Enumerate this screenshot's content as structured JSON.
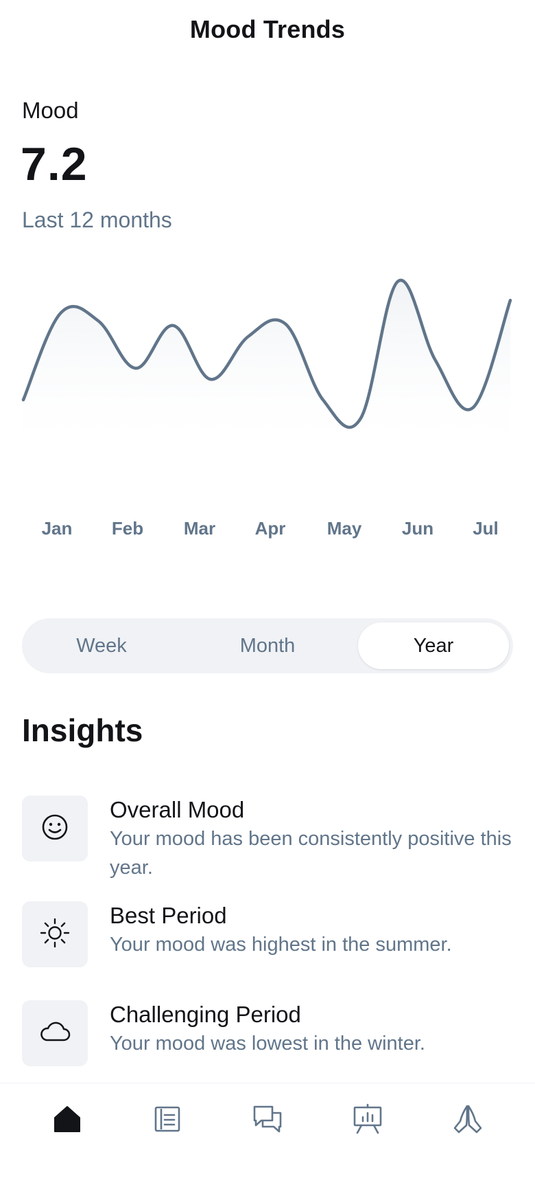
{
  "header": {
    "title": "Mood Trends"
  },
  "metric": {
    "label": "Mood",
    "value": "7.2",
    "period": "Last 12 months"
  },
  "chart_data": {
    "type": "area",
    "title": "",
    "xlabel": "",
    "ylabel": "",
    "categories": [
      "Jan",
      "Feb",
      "Mar",
      "Apr",
      "May",
      "Jun",
      "Jul"
    ],
    "grid": false,
    "legend": "none",
    "series": [
      {
        "values": [
          0.2,
          0.75,
          0.7,
          0.4,
          0.67,
          0.33,
          0.6,
          0.68,
          0.2,
          0.08,
          0.95,
          0.45,
          0.15,
          0.83
        ]
      }
    ],
    "color": "#61758a"
  },
  "segmented": {
    "options": [
      "Week",
      "Month",
      "Year"
    ],
    "selected": "Year"
  },
  "insights": {
    "title": "Insights",
    "items": [
      {
        "icon": "smiley-icon",
        "title": "Overall Mood",
        "desc": "Your mood has been consistently positive this year."
      },
      {
        "icon": "sun-icon",
        "title": "Best Period",
        "desc": "Your mood was highest in the summer."
      },
      {
        "icon": "cloud-icon",
        "title": "Challenging Period",
        "desc": "Your mood was lowest in the winter."
      }
    ]
  },
  "nav": {
    "items": [
      {
        "icon": "home-icon",
        "active": true
      },
      {
        "icon": "journal-icon",
        "active": false
      },
      {
        "icon": "chat-icon",
        "active": false
      },
      {
        "icon": "presentation-chart-icon",
        "active": false
      },
      {
        "icon": "praying-hands-icon",
        "active": false
      }
    ]
  },
  "colors": {
    "accent": "#121417",
    "muted": "#61758a",
    "surface": "#f0f2f5"
  }
}
